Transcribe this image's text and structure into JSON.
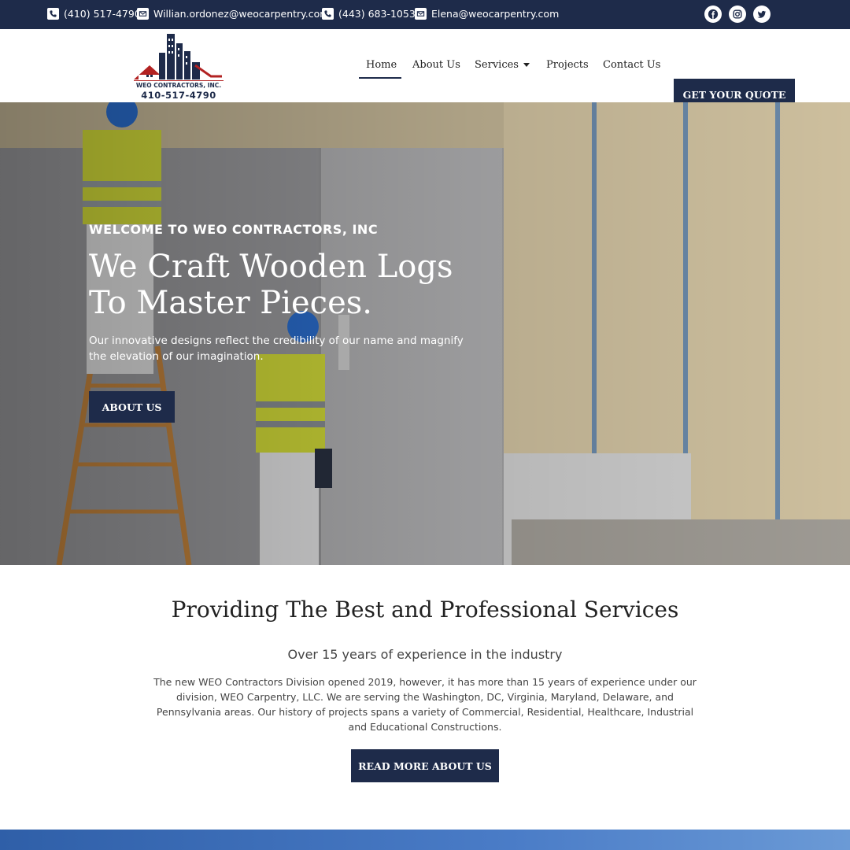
{
  "topbar": {
    "phone1": "(410) 517-4790",
    "email1": "Willian.ordonez@weocarpentry.com",
    "phone2": "(443) 683-1053",
    "email2": "Elena@weocarpentry.com",
    "social_icons": [
      "facebook-icon",
      "instagram-icon",
      "twitter-icon"
    ],
    "background": "#1e2b4a"
  },
  "header": {
    "logo_name": "WEO CONTRACTORS, INC.",
    "logo_phone": "410-517-4790",
    "nav": {
      "home": "Home",
      "about": "About Us",
      "services": "Services",
      "projects": "Projects",
      "contact": "Contact Us"
    },
    "quote_button": "GET YOUR QUOTE"
  },
  "hero": {
    "kicker": "WELCOME TO WEO CONTRACTORS, INC",
    "title": "We Craft Wooden Logs To Master Pieces.",
    "subtitle": "Our innovative designs reflect the credibility of our name and magnify the elevation of our imagination.",
    "button": "ABOUT US"
  },
  "services": {
    "title": "Providing The Best and Professional Services",
    "subtitle": "Over 15 years of experience in the industry",
    "body": "The new WEO Contractors Division opened 2019, however, it has more than 15 years of experience under our division, WEO Carpentry, LLC. We are serving the Washington, DC, Virginia, Maryland, Delaware, and Pennsylvania areas. Our history of projects spans a variety of Commercial, Residential, Healthcare, Industrial and Educational Constructions.",
    "button": "READ MORE ABOUT US"
  },
  "colors": {
    "primary": "#1e2b4a",
    "accent_red": "#b22222",
    "band_blue": "#2f5fa8"
  }
}
